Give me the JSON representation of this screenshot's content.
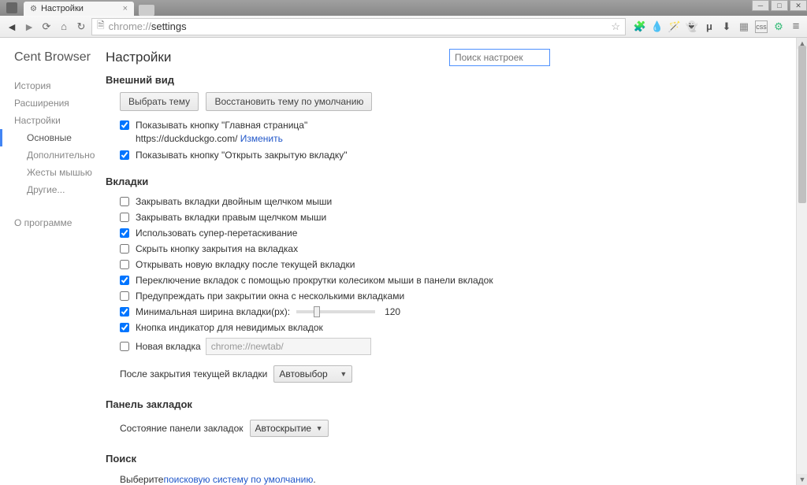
{
  "window": {
    "min": "─",
    "max": "□",
    "close": "✕"
  },
  "tab": {
    "title": "Настройки"
  },
  "omnibox": {
    "scheme": "chrome://",
    "path": "settings"
  },
  "ext_icons": {
    "puzzle": "🧩",
    "drop": "💧",
    "wand": "🪄",
    "ghost": "👻",
    "mu": "μ",
    "down": "⬇",
    "grid": "▦",
    "css": "css",
    "gear": "⚙",
    "menu": "≡"
  },
  "sidebar": {
    "brand": "Cent Browser",
    "history": "История",
    "extensions": "Расширения",
    "settings": "Настройки",
    "sub_basic": "Основные",
    "sub_advanced": "Дополнительно",
    "sub_gestures": "Жесты мышью",
    "sub_other": "Другие...",
    "about": "О программе"
  },
  "page": {
    "title": "Настройки",
    "search_placeholder": "Поиск настроек"
  },
  "appearance": {
    "heading": "Внешний вид",
    "choose_theme": "Выбрать тему",
    "reset_theme": "Восстановить тему по умолчанию",
    "show_home_btn": "Показывать кнопку \"Главная страница\"",
    "home_url": "https://duckduckgo.com/",
    "change": "Изменить",
    "show_reopen_tab": "Показывать кнопку \"Открыть закрытую вкладку\""
  },
  "tabs": {
    "heading": "Вкладки",
    "close_double": "Закрывать вкладки двойным щелчком мыши",
    "close_right": "Закрывать вкладки правым щелчком мыши",
    "super_drag": "Использовать супер-перетаскивание",
    "hide_close": "Скрыть кнопку закрытия на вкладках",
    "open_after_current": "Открывать новую вкладку после текущей вкладки",
    "wheel_switch": "Переключение вкладок с помощью прокрутки колесиком мыши в панели вкладок",
    "warn_multiple": "Предупреждать при закрытии окна с несколькими вкладками",
    "min_width_label": "Минимальная ширина вкладки(px):",
    "min_width_value": "120",
    "indicator_hidden": "Кнопка индикатор для невидимых вкладок",
    "new_tab_label": "Новая вкладка",
    "new_tab_url": "chrome://newtab/",
    "after_close_label": "После закрытия текущей вкладки",
    "after_close_value": "Автовыбор"
  },
  "bookmarks": {
    "heading": "Панель закладок",
    "state_label": "Состояние панели закладок",
    "state_value": "Автоскрытие"
  },
  "search": {
    "heading": "Поиск",
    "choose_text": "Выберите ",
    "link_text": "поисковую систему по умолчанию",
    "period": "."
  }
}
